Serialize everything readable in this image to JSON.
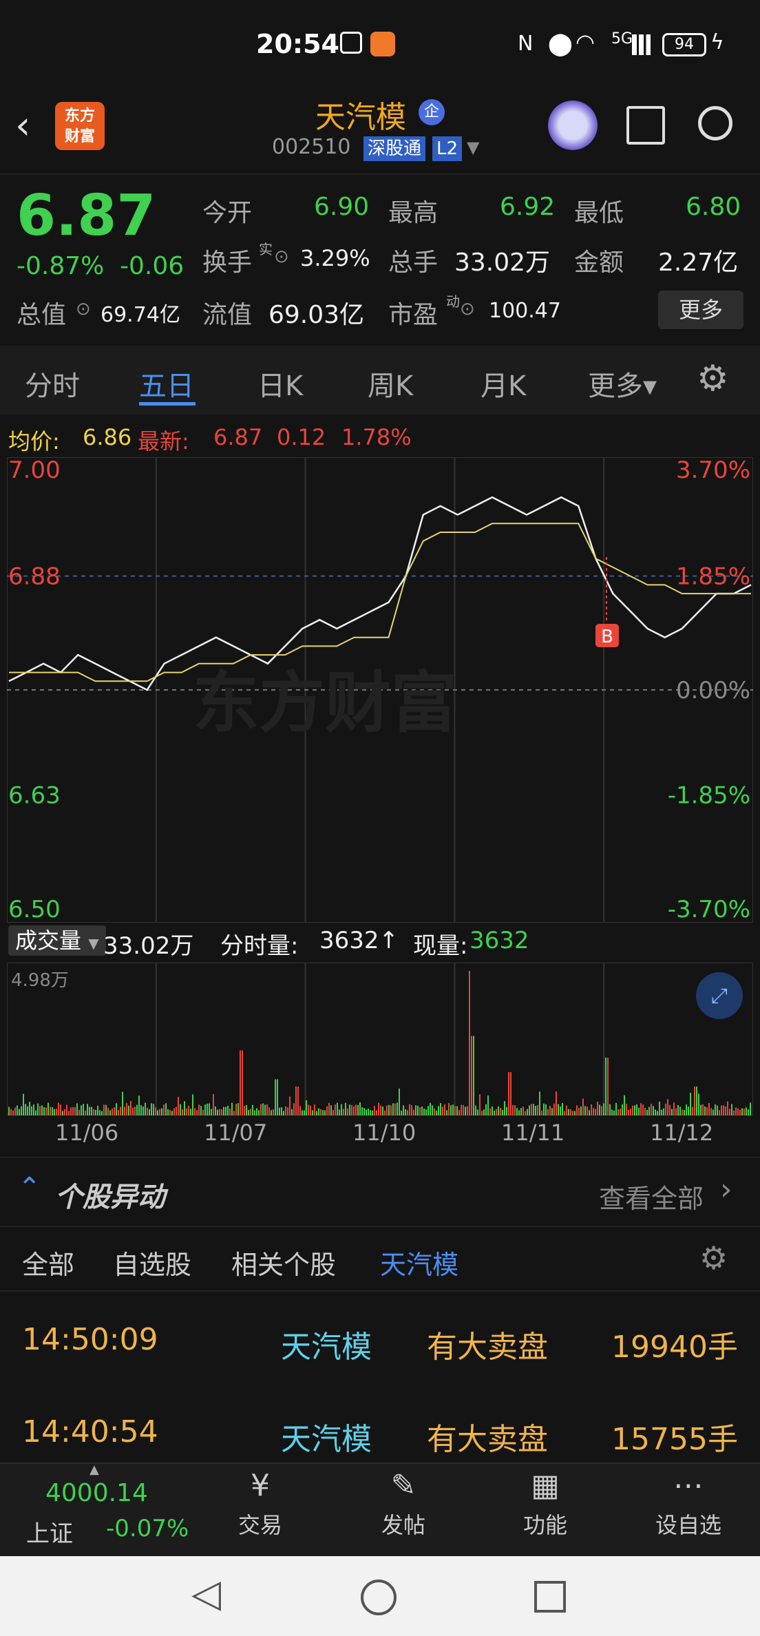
{
  "status_bar": {
    "time": "20:54",
    "battery": "94",
    "network": "5G"
  },
  "header": {
    "logo_line1": "东方",
    "logo_line2": "财富",
    "stock_name": "天汽模",
    "badge": "企",
    "stock_code": "002510",
    "tag_sgt": "深股通",
    "tag_l2": "L2"
  },
  "quote": {
    "price": "6.87",
    "change_pct": "-0.87%",
    "change": "-0.06",
    "open_label": "今开",
    "open": "6.90",
    "high_label": "最高",
    "high": "6.92",
    "low_label": "最低",
    "low": "6.80",
    "turnover_label": "换手",
    "turnover_sup": "实",
    "turnover": "3.29%",
    "volume_label": "总手",
    "volume": "33.02万",
    "amount_label": "金额",
    "amount": "2.27亿",
    "mktcap_label": "总值",
    "mktcap": "69.74亿",
    "float_label": "流值",
    "float": "69.03亿",
    "pe_label": "市盈",
    "pe_sup": "动",
    "pe": "100.47",
    "more": "更多"
  },
  "tabs": [
    "分时",
    "五日",
    "日K",
    "周K",
    "月K",
    "更多▾"
  ],
  "active_tab": "五日",
  "avg_info": {
    "avg_label": "均价:",
    "avg": "6.86",
    "latest_label": "最新:",
    "latest": "6.87",
    "chg": "0.12",
    "pct": "1.78%"
  },
  "chart_data": {
    "type": "line",
    "x": [
      "11/06",
      "11/07",
      "11/10",
      "11/11",
      "11/12"
    ],
    "y_left_ticks": [
      "7.00",
      "6.88",
      "6.63",
      "6.50"
    ],
    "y_right_ticks": [
      "3.70%",
      "1.85%",
      "0.00%",
      "-1.85%",
      "-3.70%"
    ],
    "ylim": [
      6.5,
      7.0
    ],
    "series": [
      {
        "values": [
          6.76,
          6.77,
          6.78,
          6.77,
          6.79,
          6.78,
          6.77,
          6.76,
          6.75,
          6.78,
          6.79,
          6.8,
          6.81,
          6.8,
          6.79,
          6.78,
          6.8,
          6.82,
          6.83,
          6.82,
          6.83,
          6.84,
          6.85,
          6.88,
          6.95,
          6.96,
          6.95,
          6.96,
          6.97,
          6.96,
          6.95,
          6.96,
          6.97,
          6.96,
          6.9,
          6.86,
          6.84,
          6.82,
          6.81,
          6.82,
          6.84,
          6.86,
          6.86,
          6.87
        ]
      },
      {
        "values": [
          6.77,
          6.77,
          6.77,
          6.77,
          6.77,
          6.76,
          6.76,
          6.76,
          6.76,
          6.77,
          6.77,
          6.78,
          6.78,
          6.78,
          6.79,
          6.79,
          6.79,
          6.8,
          6.8,
          6.8,
          6.81,
          6.81,
          6.81,
          6.88,
          6.92,
          6.93,
          6.93,
          6.93,
          6.94,
          6.94,
          6.94,
          6.94,
          6.94,
          6.94,
          6.9,
          6.89,
          6.88,
          6.87,
          6.87,
          6.86,
          6.86,
          6.86,
          6.86,
          6.86
        ]
      }
    ],
    "marker": "B"
  },
  "volume": {
    "label": "成交量",
    "total": "33.02万",
    "tick_label": "分时量:",
    "tick_vol": "3632↑",
    "now_label": "现量:",
    "now_vol": "3632",
    "ymax": "4.98万"
  },
  "section": {
    "title": "个股异动",
    "view_all": "查看全部"
  },
  "sub_tabs": [
    "全部",
    "自选股",
    "相关个股",
    "天汽模"
  ],
  "events": [
    {
      "time": "14:50:09",
      "name": "天汽模",
      "event": "有大卖盘",
      "qty": "19940手"
    },
    {
      "time": "14:40:54",
      "name": "天汽模",
      "event": "有大卖盘",
      "qty": "15755手"
    }
  ],
  "bottom_nav": {
    "index_value": "4000.14",
    "index_name": "上证",
    "index_change": "-0.07%",
    "items": [
      "交易",
      "发帖",
      "功能",
      "设自选"
    ]
  }
}
